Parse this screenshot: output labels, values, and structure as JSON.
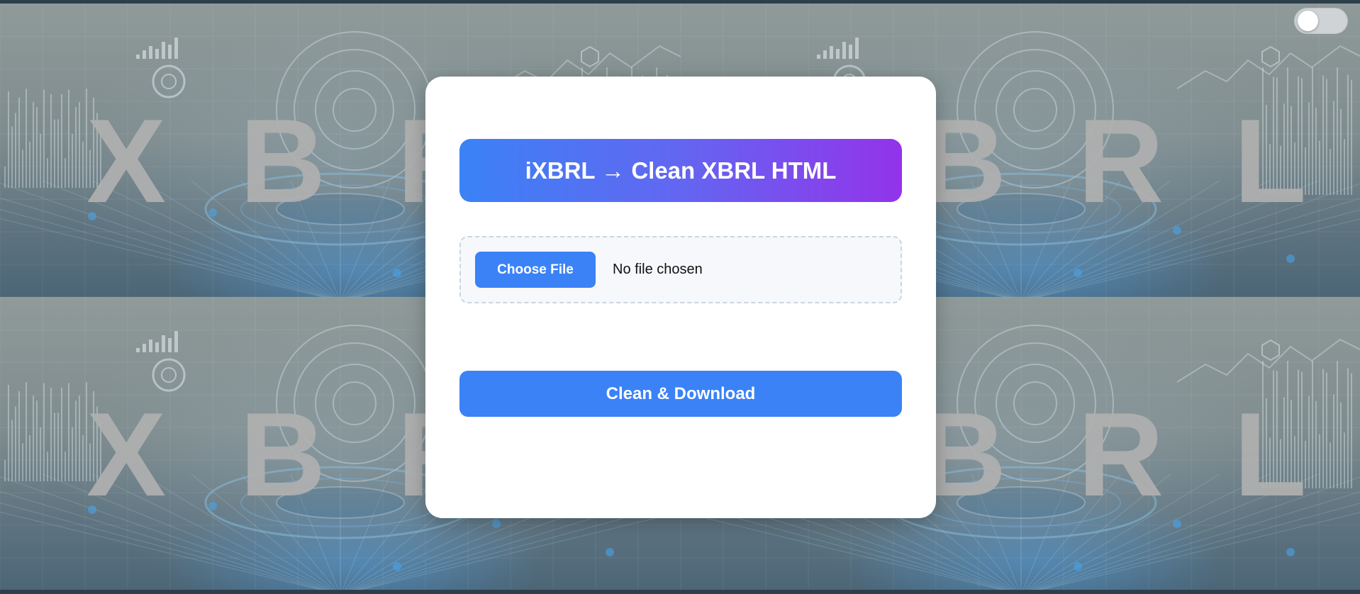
{
  "header": {
    "theme_toggle": {
      "state": "off"
    }
  },
  "background": {
    "watermark_text": "XBRL",
    "accent_color": "#4aa3e8"
  },
  "card": {
    "title": "iXBRL → Clean XBRL HTML",
    "title_gradient": [
      "#3b82f6",
      "#9333ea"
    ],
    "file_input": {
      "button_label": "Choose File",
      "status_text": "No file chosen"
    },
    "download_label": "Clean & Download",
    "button_color": "#3b82f6"
  }
}
